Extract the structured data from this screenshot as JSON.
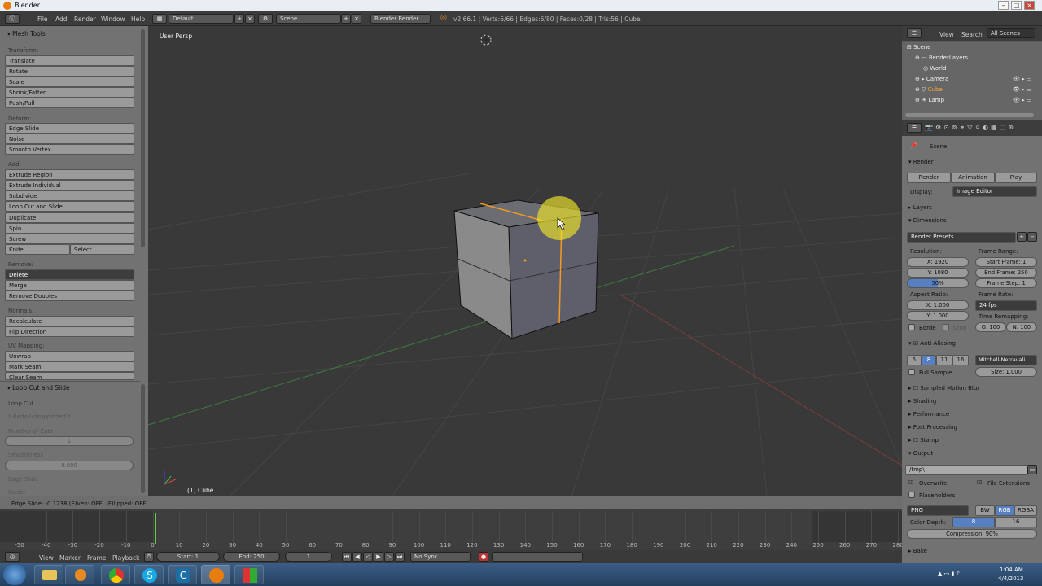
{
  "window": {
    "title": "Blender"
  },
  "info": {
    "menus": [
      "File",
      "Add",
      "Render",
      "Window",
      "Help"
    ],
    "layout": "Default",
    "scene": "Scene",
    "engine": "Blender Render",
    "stats": "v2.66.1 | Verts:6/66 | Edges:6/80 | Faces:0/28 | Tris:56 | Cube"
  },
  "toolshelf": {
    "header": "Mesh Tools",
    "transform_label": "Transform:",
    "transform": [
      "Translate",
      "Rotate",
      "Scale",
      "Shrink/Fatten",
      "Push/Pull"
    ],
    "deform_label": "Deform:",
    "deform": [
      "Edge Slide",
      "Noise",
      "Smooth Vertex"
    ],
    "add_label": "Add:",
    "add": [
      "Extrude Region",
      "Extrude Individual",
      "Subdivide",
      "Loop Cut and Slide",
      "Duplicate",
      "Spin",
      "Screw"
    ],
    "knife": "Knife",
    "select": "Select",
    "remove_label": "Remove:",
    "delete": "Delete",
    "remove": [
      "Merge",
      "Remove Doubles"
    ],
    "normals_label": "Normals:",
    "normals": [
      "Recalculate",
      "Flip Direction"
    ],
    "uv_label": "UV Mapping:",
    "uv": [
      "Unwrap",
      "Mark Seam",
      "Clear Seam"
    ],
    "op_header": "Loop Cut and Slide",
    "loop_cut": "Loop Cut",
    "unsupported": "* Redo Unsupported *",
    "cuts_label": "Number of Cuts",
    "cuts_value": "1",
    "smooth_label": "Smoothness",
    "smooth_value": "0.000",
    "edge_slide": "Edge Slide",
    "factor": "Factor"
  },
  "viewport": {
    "persp": "User Persp",
    "object": "(1) Cube",
    "status": "Edge Slide: -0.1238 (E)ven: OFF, (F)lipped: OFF"
  },
  "timeline": {
    "ticks": [
      "-50",
      "-40",
      "-30",
      "-20",
      "-10",
      "0",
      "10",
      "20",
      "30",
      "40",
      "50",
      "60",
      "70",
      "80",
      "90",
      "100",
      "110",
      "120",
      "130",
      "140",
      "150",
      "160",
      "170",
      "180",
      "190",
      "200",
      "210",
      "220",
      "230",
      "240",
      "250",
      "260",
      "270",
      "280"
    ],
    "menus": [
      "View",
      "Marker",
      "Frame",
      "Playback"
    ],
    "start": "Start: 1",
    "end": "End: 250",
    "current": "1",
    "sync": "No Sync"
  },
  "outliner": {
    "menus": [
      "View",
      "Search"
    ],
    "filter": "All Scenes",
    "items": [
      "Scene",
      "RenderLayers",
      "World",
      "Camera",
      "Cube",
      "Lamp"
    ]
  },
  "properties": {
    "scene": "Scene",
    "render": "Render",
    "render_btn": "Render",
    "animation_btn": "Animation",
    "play_btn": "Play",
    "display_label": "Display:",
    "display_value": "Image Editor",
    "layers": "Layers",
    "dimensions": "Dimensions",
    "presets": "Render Presets",
    "resolution": "Resolution:",
    "res_x": "X: 1920",
    "res_y": "Y: 1080",
    "res_pct": "50%",
    "frame_range": "Frame Range:",
    "start_frame": "Start Frame: 1",
    "end_frame": "End Frame: 250",
    "frame_step": "Frame Step: 1",
    "aspect": "Aspect Ratio:",
    "asp_x": "X: 1.000",
    "asp_y": "Y: 1.000",
    "frame_rate": "Frame Rate:",
    "fps": "24 fps",
    "remap": "Time Remapping:",
    "remap_o": "O: 100",
    "remap_n": "N: 100",
    "border": "Borde",
    "crop": "Crop",
    "aa": "Anti-Aliasing",
    "aa_levels": [
      "5",
      "8",
      "11",
      "16"
    ],
    "aa_filter": "Mitchell-Netravali",
    "full_sample": "Full Sample",
    "size": "Size: 1.000",
    "motion_blur": "Sampled Motion Blur",
    "shading": "Shading",
    "performance": "Performance",
    "post": "Post Processing",
    "stamp": "Stamp",
    "output": "Output",
    "path": "/tmp\\",
    "overwrite": "Overwrite",
    "file_ext": "File Extensions",
    "placeholders": "Placeholders",
    "format": "PNG",
    "bw": "BW",
    "rgb": "RGB",
    "rgba": "RGBA",
    "color_depth": "Color Depth:",
    "depth8": "8",
    "depth16": "16",
    "compression": "Compression: 90%",
    "bake": "Bake"
  },
  "taskbar": {
    "time": "1:04 AM",
    "date": "4/4/2013"
  }
}
